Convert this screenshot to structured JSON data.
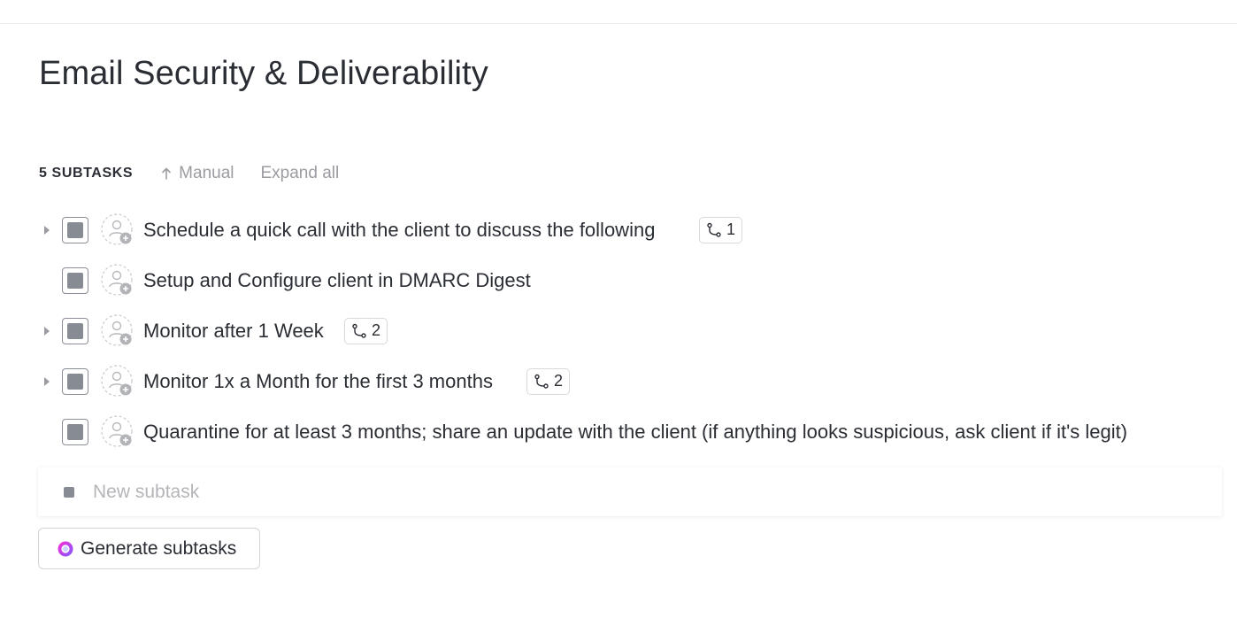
{
  "page": {
    "title": "Email Security & Deliverability"
  },
  "toolbar": {
    "subtask_count": "5 SUBTASKS",
    "sort_label": "Manual",
    "expand_label": "Expand all"
  },
  "subtasks": [
    {
      "title": "Schedule a quick call with the client to discuss the following",
      "has_children": true,
      "child_count": "1"
    },
    {
      "title": "Setup and Configure client in DMARC Digest",
      "has_children": false,
      "child_count": ""
    },
    {
      "title": "Monitor after 1 Week",
      "has_children": true,
      "child_count": "2"
    },
    {
      "title": "Monitor 1x a Month for the first 3 months",
      "has_children": true,
      "child_count": "2"
    },
    {
      "title": "Quarantine for at least 3 months; share an update with the client (if anything looks suspicious, ask client if it's legit)",
      "has_children": false,
      "child_count": ""
    }
  ],
  "new_subtask": {
    "placeholder": "New subtask"
  },
  "generate": {
    "label": "Generate subtasks"
  },
  "icons": {
    "caret": "caret-right-icon",
    "assignee": "add-assignee-icon",
    "subtasks": "subtask-branch-icon",
    "sort": "arrow-up-icon",
    "ai": "ai-sparkle-icon"
  },
  "colors": {
    "status_gray": "#878b94",
    "ai_gradient_start": "#ff2bd1",
    "ai_gradient_end": "#7b5cff"
  }
}
